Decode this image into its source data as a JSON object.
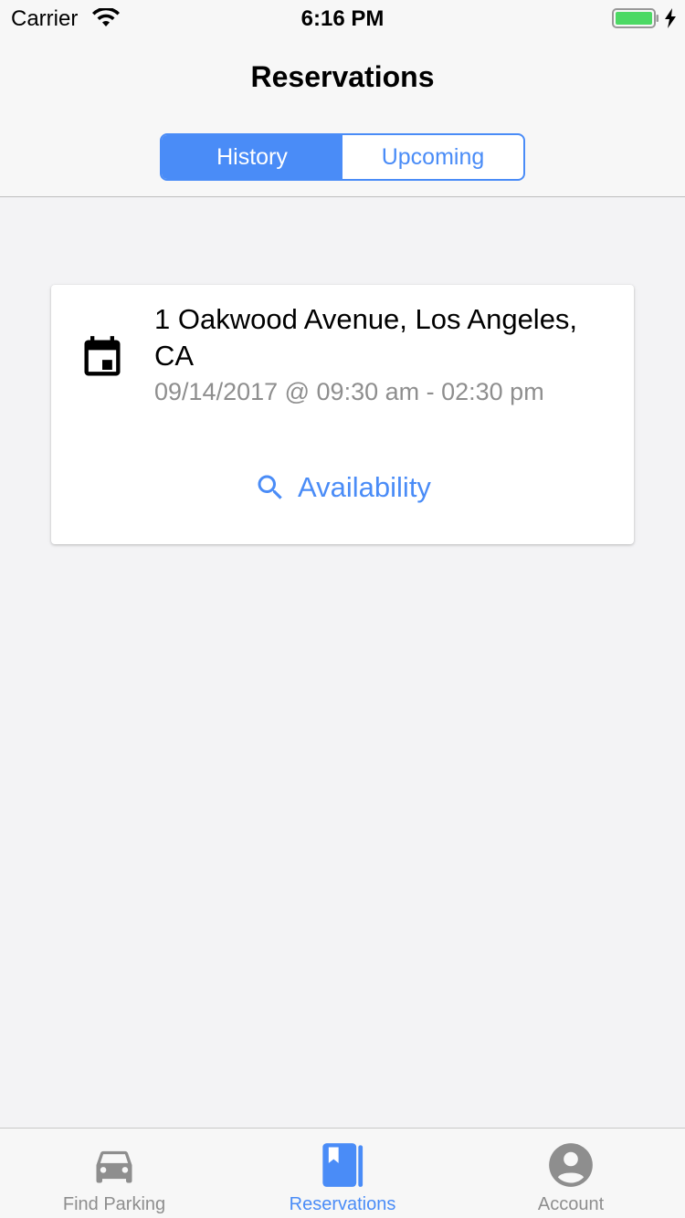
{
  "status_bar": {
    "carrier": "Carrier",
    "time": "6:16 PM",
    "battery_color": "#4cd964"
  },
  "header": {
    "title": "Reservations",
    "segments": [
      {
        "label": "History",
        "active": true
      },
      {
        "label": "Upcoming",
        "active": false
      }
    ]
  },
  "reservation": {
    "address": "1 Oakwood Avenue, Los Angeles, CA",
    "datetime": "09/14/2017 @ 09:30 am - 02:30 pm",
    "action_label": "Availability",
    "icon": "calendar-icon"
  },
  "tab_bar": {
    "tabs": [
      {
        "label": "Find Parking",
        "icon": "car-icon",
        "active": false
      },
      {
        "label": "Reservations",
        "icon": "book-icon",
        "active": true
      },
      {
        "label": "Account",
        "icon": "account-circle-icon",
        "active": false
      }
    ]
  },
  "colors": {
    "accent": "#4a8cf7",
    "inactive": "#8e8e8e",
    "background": "#f3f3f5"
  }
}
